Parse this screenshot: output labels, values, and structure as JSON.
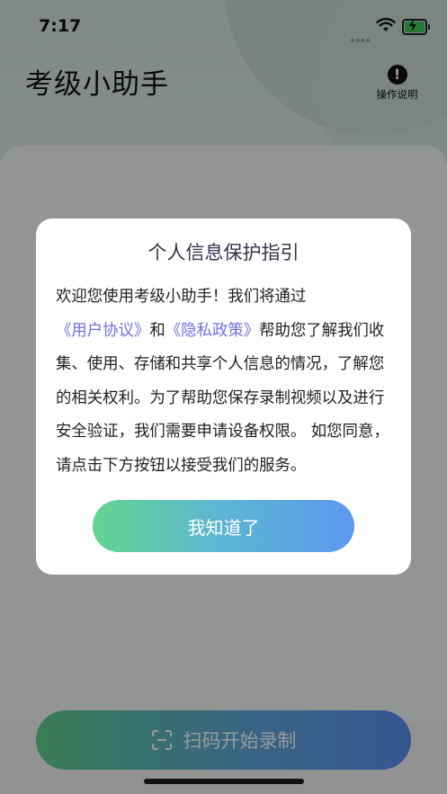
{
  "status_bar": {
    "time": "7:17"
  },
  "app": {
    "title": "考级小助手",
    "help_label": "操作说明",
    "help_icon": "exclamation-circle-icon"
  },
  "main": {
    "scan_button_label": "扫码开始录制",
    "scan_icon": "scan-frame-icon"
  },
  "dialog": {
    "title": "个人信息保护指引",
    "body_part1": "欢迎您使用考级小助手！我们将通过",
    "user_agreement_link": "《用户协议》",
    "and_text": "和",
    "privacy_policy_link": "《隐私政策》",
    "body_part2": "帮助您了解我们收集、使用、存储和共享个人信息的情况，了解您的相关权利。为了帮助您保存录制视频以及进行安全验证，我们需要申请设备权限。  如您同意，请点击下方按钮以接受我们的服务。",
    "agree_button_label": "我知道了"
  },
  "colors": {
    "link": "#6f6fe6",
    "button_gradient_start": "#63d491",
    "button_gradient_end": "#5c98ef"
  }
}
